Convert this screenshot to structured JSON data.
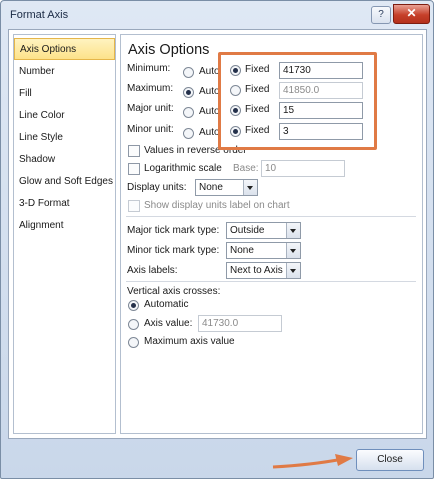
{
  "window": {
    "title": "Format Axis",
    "help_glyph": "?",
    "close_glyph": "✕"
  },
  "nav": [
    "Axis Options",
    "Number",
    "Fill",
    "Line Color",
    "Line Style",
    "Shadow",
    "Glow and Soft Edges",
    "3-D Format",
    "Alignment"
  ],
  "nav_selected": "Axis Options",
  "panel": {
    "heading": "Axis Options",
    "minimum": {
      "label": "Minimum:",
      "auto": "Auto",
      "fixed": "Fixed",
      "value": "41730",
      "selected": "fixed"
    },
    "maximum": {
      "label": "Maximum:",
      "auto": "Auto",
      "fixed": "Fixed",
      "value": "41850.0",
      "selected": "auto"
    },
    "major_unit": {
      "label": "Major unit:",
      "auto": "Auto",
      "fixed": "Fixed",
      "value": "15",
      "selected": "fixed"
    },
    "minor_unit": {
      "label": "Minor unit:",
      "auto": "Auto",
      "fixed": "Fixed",
      "value": "3",
      "selected": "fixed"
    },
    "reverse_label": "Values in reverse order",
    "log_label": "Logarithmic scale",
    "base_label": "Base:",
    "base_value": "10",
    "display_units_label": "Display units:",
    "display_units_value": "None",
    "show_units_label": "Show display units label on chart",
    "major_tick_label": "Major tick mark type:",
    "major_tick_value": "Outside",
    "minor_tick_label": "Minor tick mark type:",
    "minor_tick_value": "None",
    "axis_labels_label": "Axis labels:",
    "axis_labels_value": "Next to Axis",
    "crosses_label": "Vertical axis crosses:",
    "crosses_automatic": "Automatic",
    "crosses_value_label": "Axis value:",
    "crosses_value": "41730.0",
    "crosses_max": "Maximum axis value"
  },
  "buttons": {
    "close": "Close"
  },
  "colors": {
    "highlight": "#e07a45",
    "selected_nav": "#fde28a"
  }
}
